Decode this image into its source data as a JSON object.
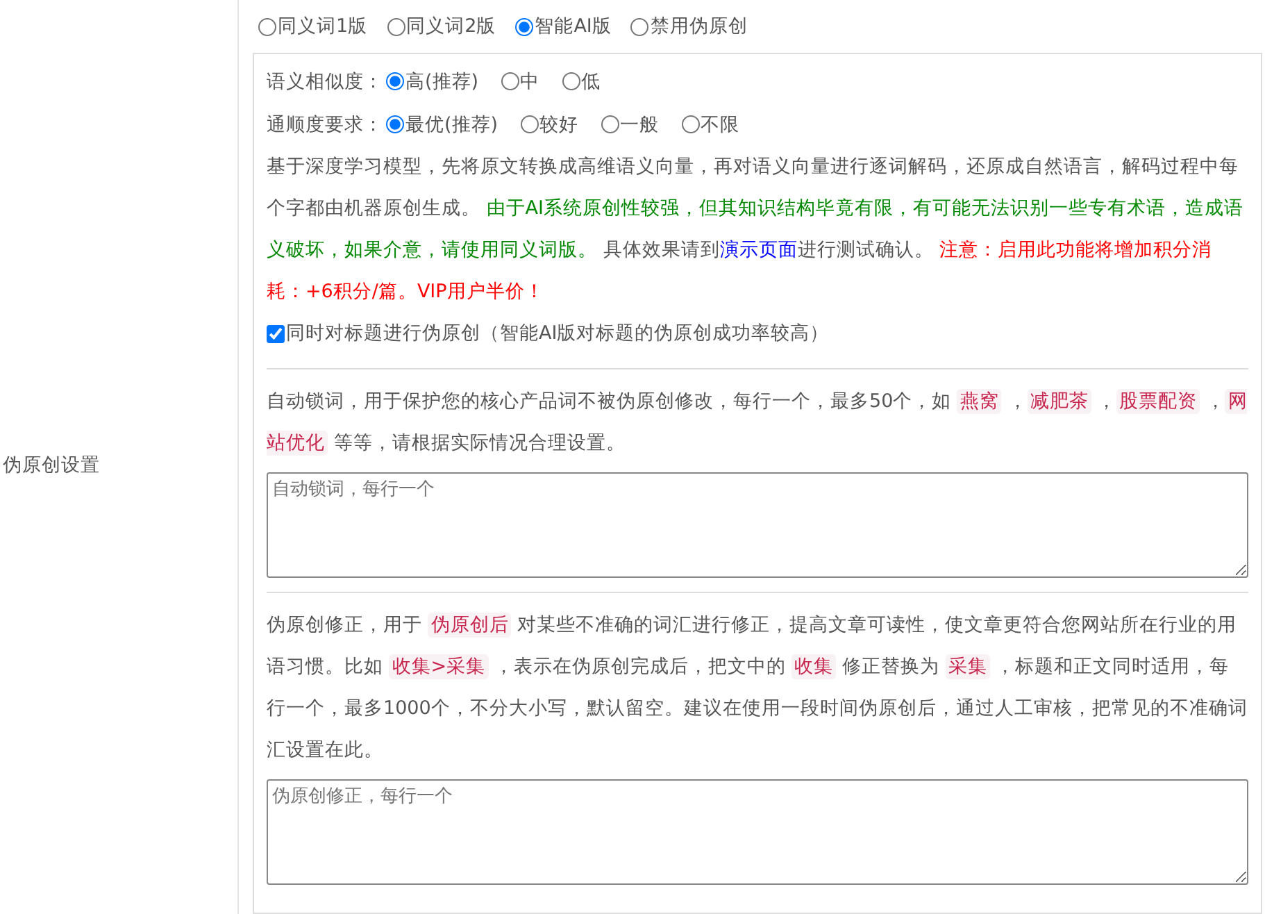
{
  "section_label": "伪原创设置",
  "modes": [
    {
      "label": "同义词1版",
      "selected": false
    },
    {
      "label": "同义词2版",
      "selected": false
    },
    {
      "label": "智能AI版",
      "selected": true
    },
    {
      "label": "禁用伪原创",
      "selected": false
    }
  ],
  "similarity": {
    "label": "语义相似度：",
    "options": [
      {
        "label": "高(推荐)",
        "selected": true
      },
      {
        "label": "中",
        "selected": false
      },
      {
        "label": "低",
        "selected": false
      }
    ]
  },
  "fluency": {
    "label": "通顺度要求：",
    "options": [
      {
        "label": "最优(推荐)",
        "selected": true
      },
      {
        "label": "较好",
        "selected": false
      },
      {
        "label": "一般",
        "selected": false
      },
      {
        "label": "不限",
        "selected": false
      }
    ]
  },
  "ai_description": [
    {
      "kind": "plain",
      "text": "基于深度学习模型，先将原文转换成高维语义向量，再对语义向量进行逐词解码，还原成自然语言，解码过程中每个字都由机器原创生成。 "
    },
    {
      "kind": "green",
      "text": "由于AI系统原创性较强，但其知识结构毕竟有限，有可能无法识别一些专有术语，造成语义破坏，如果介意，请使用同义词版。"
    },
    {
      "kind": "plain",
      "text": " 具体效果请到"
    },
    {
      "kind": "link",
      "text": "演示页面"
    },
    {
      "kind": "plain",
      "text": "进行测试确认。 "
    },
    {
      "kind": "red",
      "text": "注意：启用此功能将增加积分消耗：+6积分/篇。VIP用户半价！"
    }
  ],
  "title_option": {
    "label": "同时对标题进行伪原创（智能AI版对标题的伪原创成功率较高）",
    "checked": true
  },
  "lock_words": {
    "description": [
      {
        "kind": "plain",
        "text": "自动锁词，用于保护您的核心产品词不被伪原创修改，每行一个，最多50个，如 "
      },
      {
        "kind": "tag",
        "text": "燕窝"
      },
      {
        "kind": "plain",
        "text": " ，"
      },
      {
        "kind": "tag",
        "text": "减肥茶"
      },
      {
        "kind": "plain",
        "text": " ，"
      },
      {
        "kind": "tag",
        "text": "股票配资"
      },
      {
        "kind": "plain",
        "text": " ，"
      },
      {
        "kind": "tag",
        "text": "网站优化"
      },
      {
        "kind": "plain",
        "text": " 等等，请根据实际情况合理设置。"
      }
    ],
    "placeholder": "自动锁词，每行一个"
  },
  "corrections": {
    "description": [
      {
        "kind": "plain",
        "text": "伪原创修正，用于 "
      },
      {
        "kind": "tag",
        "text": "伪原创后"
      },
      {
        "kind": "plain",
        "text": " 对某些不准确的词汇进行修正，提高文章可读性，使文章更符合您网站所在行业的用语习惯。比如 "
      },
      {
        "kind": "tag",
        "text": "收集>采集"
      },
      {
        "kind": "plain",
        "text": " ，表示在伪原创完成后，把文中的 "
      },
      {
        "kind": "tag",
        "text": "收集"
      },
      {
        "kind": "plain",
        "text": " 修正替换为 "
      },
      {
        "kind": "tag",
        "text": "采集"
      },
      {
        "kind": "plain",
        "text": " ，标题和正文同时适用，每行一个，最多1000个，不分大小写，默认留空。建议在使用一段时间伪原创后，通过人工审核，把常见的不准确词汇设置在此。"
      }
    ],
    "placeholder": "伪原创修正，每行一个"
  }
}
